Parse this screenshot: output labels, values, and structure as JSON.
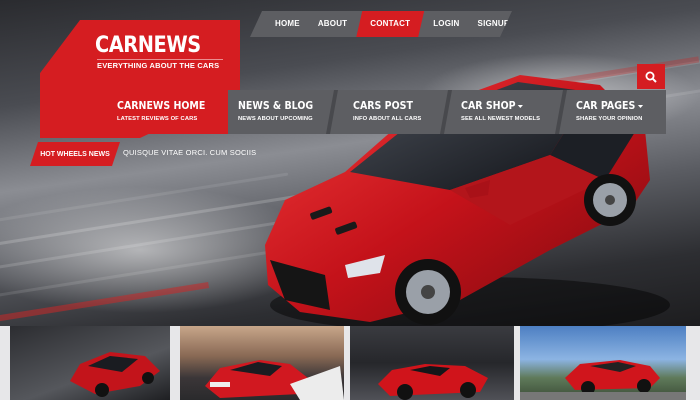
{
  "top_nav": {
    "items": [
      {
        "label": "HOME",
        "active": false
      },
      {
        "label": "ABOUT",
        "active": false
      },
      {
        "label": "CONTACT",
        "active": true
      },
      {
        "label": "LOGIN",
        "active": false
      },
      {
        "label": "SIGNUP",
        "active": false
      }
    ]
  },
  "logo": {
    "title": "CARNEWS",
    "tagline": "EVERYTHING ABOUT THE CARS"
  },
  "search": {
    "icon": "search-icon"
  },
  "main_nav": {
    "items": [
      {
        "title": "CARNEWS HOME",
        "subtitle": "LATEST REVIEWS OF CARS"
      },
      {
        "title": "NEWS & BLOG",
        "subtitle": "NEWS ABOUT UPCOMING"
      },
      {
        "title": "CARS POST",
        "subtitle": "INFO ABOUT ALL CARS"
      },
      {
        "title": "CAR SHOP",
        "subtitle": "SEE ALL NEWEST MODELS"
      },
      {
        "title": "CAR PAGES",
        "subtitle": "SHARE YOUR OPINION"
      }
    ]
  },
  "breaking": {
    "label": "HOT WHEELS NEWS",
    "text": "QUISQUE VITAE ORCI. CUM SOCIIS"
  },
  "colors": {
    "accent": "#d51d21",
    "nav_gray": "#5d5e62"
  }
}
